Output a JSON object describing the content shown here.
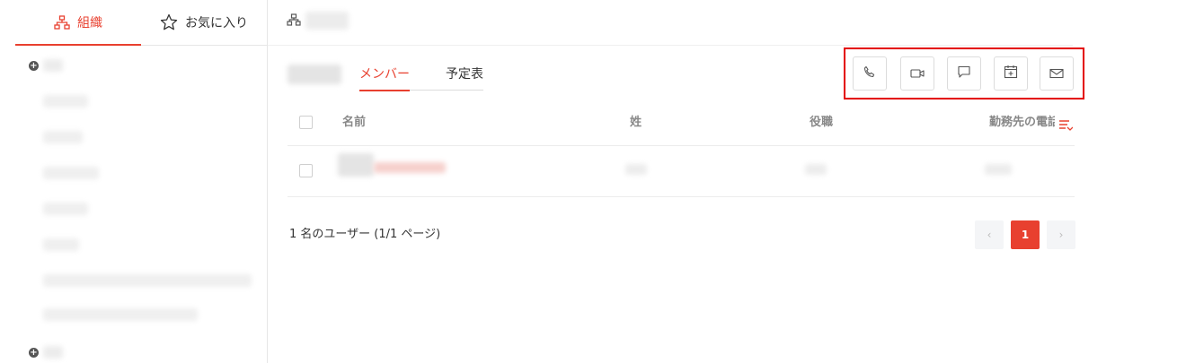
{
  "sidebar": {
    "tabs": [
      {
        "label": "組織",
        "active": true,
        "icon": "org-chart-icon"
      },
      {
        "label": "お気に入り",
        "active": false,
        "icon": "star-icon"
      }
    ]
  },
  "breadcrumb": {
    "icon": "org-chart-icon"
  },
  "main": {
    "tabs": [
      {
        "label": "メンバー",
        "active": true
      },
      {
        "label": "予定表",
        "active": false
      }
    ],
    "actions": [
      {
        "name": "call",
        "icon": "phone-icon"
      },
      {
        "name": "video",
        "icon": "video-camera-icon"
      },
      {
        "name": "chat",
        "icon": "chat-bubble-icon"
      },
      {
        "name": "schedule",
        "icon": "calendar-add-icon"
      },
      {
        "name": "mail",
        "icon": "mail-icon"
      }
    ],
    "table": {
      "columns": [
        "名前",
        "姓",
        "役職",
        "勤務先の電話"
      ],
      "rows_hint": 1
    },
    "footer": {
      "summary": "1 名のユーザー (1/1 ページ)"
    },
    "pagination": {
      "current": "1",
      "prev": "‹",
      "next": "›"
    }
  },
  "colors": {
    "accent": "#e8402f",
    "highlight": "#e30000"
  }
}
